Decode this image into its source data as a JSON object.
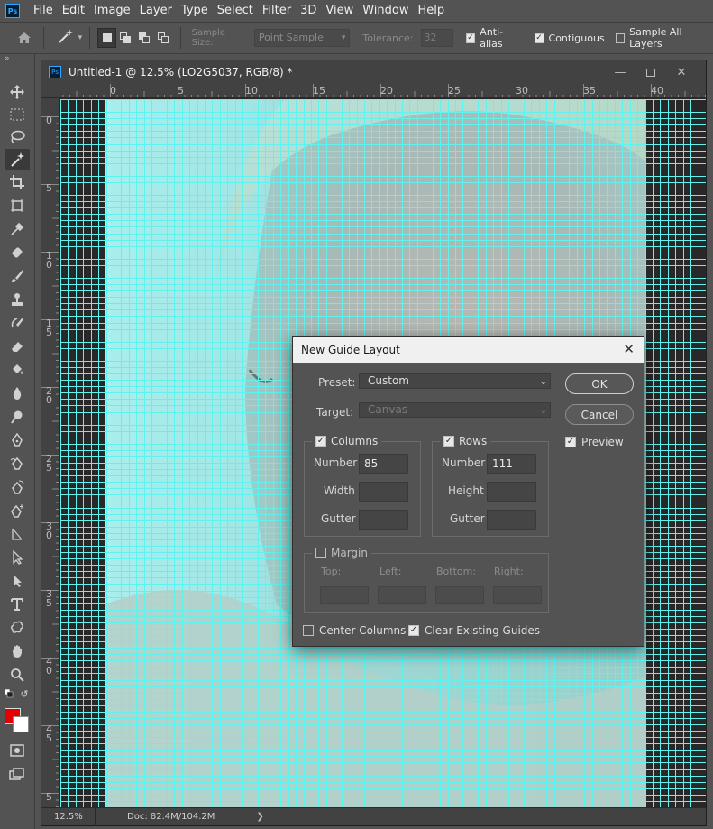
{
  "app": {
    "logo": "Ps"
  },
  "menu": [
    "File",
    "Edit",
    "Image",
    "Layer",
    "Type",
    "Select",
    "Filter",
    "3D",
    "View",
    "Window",
    "Help"
  ],
  "options": {
    "home_icon": "home-icon",
    "tool_icon": "magic-wand-icon",
    "sample_size_label": "Sample Size:",
    "sample_size_value": "Point Sample",
    "tolerance_label": "Tolerance:",
    "tolerance_value": "32",
    "anti_alias": "Anti-alias",
    "contiguous": "Contiguous",
    "sample_all_layers": "Sample All Layers"
  },
  "toolbar": {
    "collapse": "»",
    "tools": [
      "move",
      "rectangular-marquee",
      "lasso",
      "magic-wand",
      "crop",
      "frame",
      "eyedropper",
      "spot-healing-brush",
      "brush",
      "clone-stamp",
      "history-brush",
      "eraser",
      "paint-bucket",
      "blur",
      "dodge",
      "pen",
      "freeform-pen",
      "curvature-pen",
      "add-anchor-point",
      "path-selection",
      "direct-selection",
      "type",
      "custom-shape",
      "hand",
      "zoom"
    ],
    "foreground_color": "#e20000",
    "background_color": "#ffffff"
  },
  "document": {
    "title": "Untitled-1 @ 12.5% (LO2G5037, RGB/8) *",
    "zoom": "12.5%",
    "doc_size": "Doc: 82.4M/104.2M",
    "hruler": [
      "0",
      "5",
      "10",
      "15",
      "20",
      "25",
      "30",
      "35",
      "40"
    ],
    "vruler": [
      "0",
      "5",
      "10",
      "15",
      "20",
      "25",
      "30",
      "35",
      "40",
      "45",
      "5"
    ],
    "guide_color": "#5ff2ee"
  },
  "dialog": {
    "title": "New Guide Layout",
    "preset_label": "Preset:",
    "preset_value": "Custom",
    "target_label": "Target:",
    "target_value": "Canvas",
    "columns": {
      "label": "Columns",
      "checked": true,
      "number_label": "Number",
      "number": "85",
      "width_label": "Width",
      "width": "",
      "gutter_label": "Gutter",
      "gutter": ""
    },
    "rows": {
      "label": "Rows",
      "checked": true,
      "number_label": "Number",
      "number": "111",
      "height_label": "Height",
      "height": "",
      "gutter_label": "Gutter",
      "gutter": ""
    },
    "margin": {
      "label": "Margin",
      "checked": false,
      "top": "Top:",
      "left": "Left:",
      "bottom": "Bottom:",
      "right": "Right:"
    },
    "center_columns": "Center Columns",
    "center_columns_checked": false,
    "clear_guides": "Clear Existing Guides",
    "clear_guides_checked": true,
    "ok": "OK",
    "cancel": "Cancel",
    "preview": "Preview",
    "preview_checked": true
  }
}
